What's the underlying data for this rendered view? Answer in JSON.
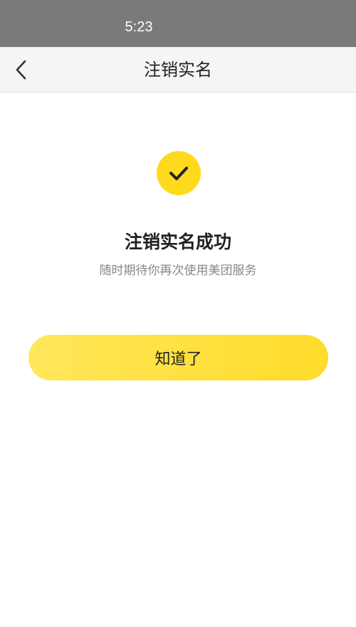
{
  "status_bar": {
    "time": "5:23"
  },
  "nav": {
    "title": "注销实名",
    "back_icon": "chevron-left-icon"
  },
  "result": {
    "icon": "checkmark-icon",
    "title": "注销实名成功",
    "subtitle": "随时期待你再次使用美团服务"
  },
  "actions": {
    "ok_label": "知道了"
  },
  "colors": {
    "accent": "#ffd91c",
    "status_bar": "#7a7a7a",
    "nav_bg": "#f5f5f5",
    "subtitle": "#888888"
  }
}
